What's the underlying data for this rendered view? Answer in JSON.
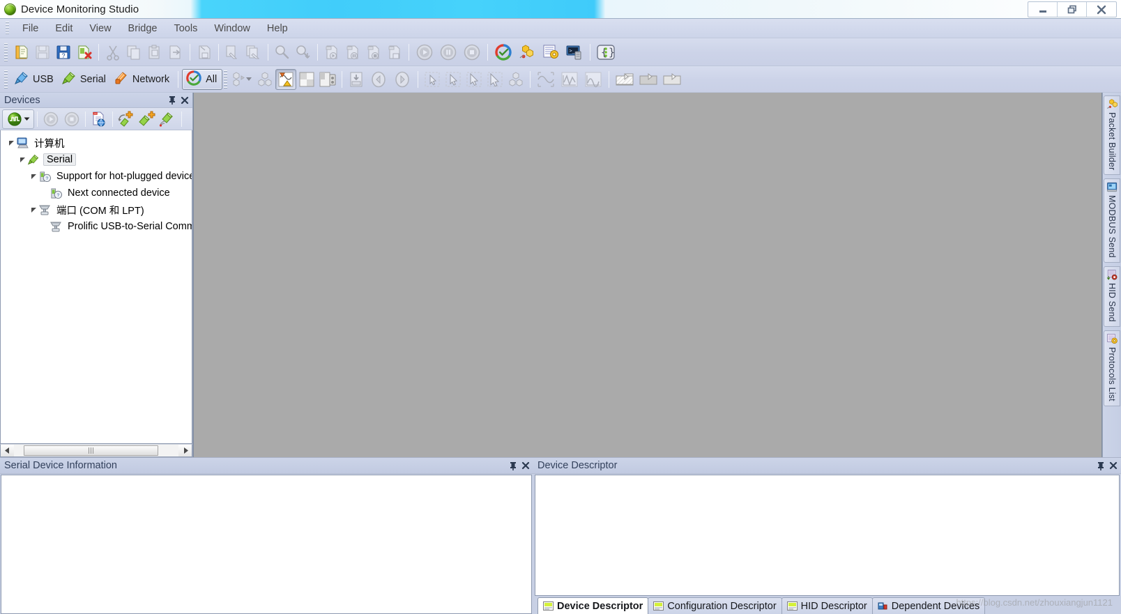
{
  "window": {
    "title": "Device Monitoring Studio",
    "app_icon": "green-sphere-icon",
    "minimize_label": "Minimize",
    "restore_label": "Restore",
    "close_label": "Close"
  },
  "menubar": {
    "items": [
      {
        "label": "File"
      },
      {
        "label": "Edit"
      },
      {
        "label": "View"
      },
      {
        "label": "Bridge"
      },
      {
        "label": "Tools"
      },
      {
        "label": "Window"
      },
      {
        "label": "Help"
      }
    ]
  },
  "toolbar_main": {
    "buttons": [
      {
        "name": "new-session-icon",
        "tooltip": "New"
      },
      {
        "name": "save-icon",
        "tooltip": "Save"
      },
      {
        "name": "save-as-icon",
        "tooltip": "Save As"
      },
      {
        "name": "close-document-icon",
        "tooltip": "Close"
      },
      {
        "name": "cut-icon",
        "tooltip": "Cut"
      },
      {
        "name": "copy-icon",
        "tooltip": "Copy"
      },
      {
        "name": "paste-icon",
        "tooltip": "Paste"
      },
      {
        "name": "export-icon",
        "tooltip": "Export"
      },
      {
        "name": "save-binary-icon",
        "tooltip": "Save Binary"
      },
      {
        "name": "clear-window-icon",
        "tooltip": "Clear"
      },
      {
        "name": "clear-all-icon",
        "tooltip": "Clear All"
      },
      {
        "name": "find-icon",
        "tooltip": "Find"
      },
      {
        "name": "find-next-icon",
        "tooltip": "Find Next"
      },
      {
        "name": "log-start-icon",
        "tooltip": "Start Logging"
      },
      {
        "name": "log-pause-icon",
        "tooltip": "Pause Logging"
      },
      {
        "name": "log-stop-icon",
        "tooltip": "Stop Logging"
      },
      {
        "name": "log-save-icon",
        "tooltip": "Save Log"
      },
      {
        "name": "play-icon",
        "tooltip": "Start"
      },
      {
        "name": "pause-icon",
        "tooltip": "Pause"
      },
      {
        "name": "stop-icon",
        "tooltip": "Stop"
      },
      {
        "name": "all-sessions-icon",
        "tooltip": "All"
      },
      {
        "name": "packet-builder-icon",
        "tooltip": "Packet Builder"
      },
      {
        "name": "protocols-list-icon",
        "tooltip": "Protocols List"
      },
      {
        "name": "terminal-icon",
        "tooltip": "Terminal"
      },
      {
        "name": "script-icon",
        "tooltip": "Script"
      }
    ]
  },
  "toolbar_filters": {
    "usb_label": "USB",
    "serial_label": "Serial",
    "network_label": "Network",
    "all_label": "All",
    "usb_icon": "usb-plug-icon",
    "serial_icon": "serial-plug-icon",
    "network_icon": "network-card-icon",
    "all_icon": "all-circle-icon",
    "buttons": [
      {
        "name": "module-dropdown-icon",
        "tooltip": "Modules"
      },
      {
        "name": "module-icon",
        "tooltip": "Module"
      },
      {
        "name": "data-view-icon",
        "tooltip": "Data View"
      },
      {
        "name": "split-view-icon",
        "tooltip": "Split View"
      },
      {
        "name": "panel-view-icon",
        "tooltip": "Panel View"
      },
      {
        "name": "download-icon",
        "tooltip": "Download"
      },
      {
        "name": "prev-icon",
        "tooltip": "Previous"
      },
      {
        "name": "next-icon",
        "tooltip": "Next"
      },
      {
        "name": "select-1-icon",
        "tooltip": "Select"
      },
      {
        "name": "select-2-icon",
        "tooltip": "Select"
      },
      {
        "name": "select-3-icon",
        "tooltip": "Select"
      },
      {
        "name": "select-4-icon",
        "tooltip": "Select"
      },
      {
        "name": "cluster-icon",
        "tooltip": "Cluster"
      },
      {
        "name": "signal-scatter-icon",
        "tooltip": "Signal"
      },
      {
        "name": "waveform-1-icon",
        "tooltip": "Waveform"
      },
      {
        "name": "waveform-2-icon",
        "tooltip": "Waveform"
      },
      {
        "name": "folder-1-icon",
        "tooltip": "Folder"
      },
      {
        "name": "folder-2-icon",
        "tooltip": "Folder"
      },
      {
        "name": "folder-3-icon",
        "tooltip": "Folder"
      }
    ]
  },
  "devices_panel": {
    "caption": "Devices",
    "pin_label": "Pin",
    "close_label": "Close",
    "toolbar": [
      {
        "name": "capture-dropdown-icon",
        "tooltip": "Capture"
      },
      {
        "name": "start-icon",
        "tooltip": "Start"
      },
      {
        "name": "stop-icon",
        "tooltip": "Stop"
      },
      {
        "name": "log-web-icon",
        "tooltip": "Log"
      },
      {
        "name": "add-virtual-serial-icon",
        "tooltip": "Add Virtual Serial Port"
      },
      {
        "name": "add-serial-icon",
        "tooltip": "Add Serial Port"
      },
      {
        "name": "wireless-serial-icon",
        "tooltip": "Wireless Serial"
      }
    ],
    "tree": [
      {
        "label": "计算机",
        "depth": 0,
        "icon": "computer-icon",
        "expander": "expanded",
        "selected": false
      },
      {
        "label": "Serial",
        "depth": 1,
        "icon": "serial-plug-icon",
        "expander": "expanded",
        "selected": true
      },
      {
        "label": "Support for hot-plugged devices",
        "depth": 2,
        "icon": "device-query-icon",
        "expander": "expanded",
        "selected": false
      },
      {
        "label": "Next connected device",
        "depth": 3,
        "icon": "device-query-icon",
        "expander": "none",
        "selected": false
      },
      {
        "label": "端口 (COM 和 LPT)",
        "depth": 2,
        "icon": "port-icon",
        "expander": "expanded",
        "selected": false
      },
      {
        "label": "Prolific USB-to-Serial Comm Port",
        "depth": 3,
        "icon": "port-icon",
        "expander": "none",
        "selected": false
      }
    ]
  },
  "right_strip": {
    "tabs": [
      {
        "label": "Packet Builder",
        "icon": "packet-builder-icon"
      },
      {
        "label": "MODBUS Send",
        "icon": "modbus-send-icon"
      },
      {
        "label": "HID Send",
        "icon": "hid-send-icon"
      },
      {
        "label": "Protocols List",
        "icon": "protocols-list-icon"
      }
    ]
  },
  "serial_info_panel": {
    "caption": "Serial Device Information",
    "pin_label": "Pin",
    "close_label": "Close",
    "content": ""
  },
  "descriptor_panel": {
    "caption": "Device Descriptor",
    "pin_label": "Pin",
    "close_label": "Close",
    "content": "",
    "tabs": [
      {
        "label": "Device Descriptor",
        "icon": "descriptor-icon",
        "active": true
      },
      {
        "label": "Configuration Descriptor",
        "icon": "descriptor-icon",
        "active": false
      },
      {
        "label": "HID Descriptor",
        "icon": "descriptor-icon",
        "active": false
      },
      {
        "label": "Dependent Devices",
        "icon": "dependent-devices-icon",
        "active": false
      }
    ]
  },
  "watermark": {
    "text": "https://blog.csdn.net/zhouxiangjun1121"
  },
  "colors": {
    "workspace_gray": "#aaaaaa",
    "toolbar_blue": "#ccd3e8",
    "caption_blue": "#c2cbe2",
    "title_cyan": "#41cdfa",
    "accent_green": "#7ac70c"
  }
}
